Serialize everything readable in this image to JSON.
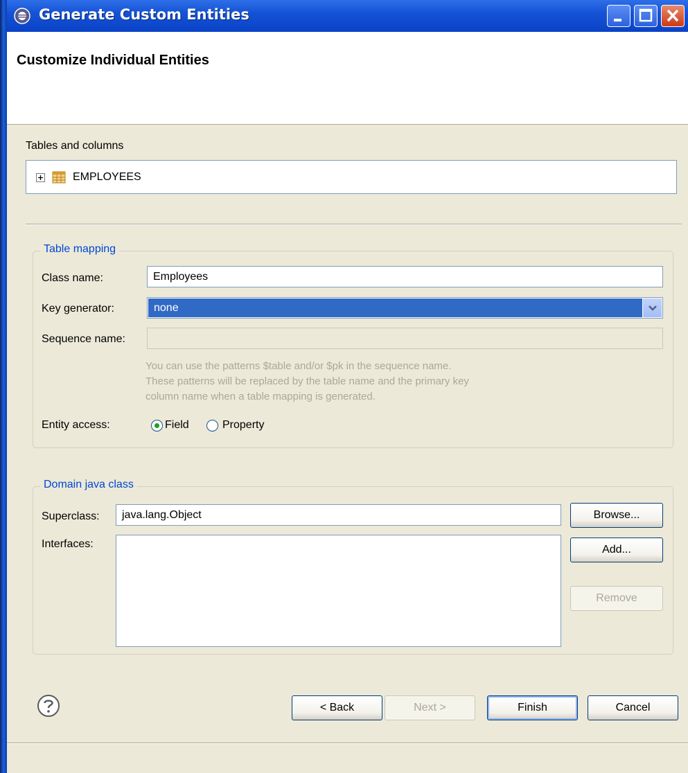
{
  "window": {
    "title": "Generate Custom Entities",
    "minimize_label": "_",
    "maximize_label": "☐",
    "close_label": "✕"
  },
  "header": {
    "title": "Customize Individual Entities"
  },
  "tables": {
    "label": "Tables and columns",
    "items": [
      {
        "expander": "⊞",
        "label": "EMPLOYEES"
      }
    ]
  },
  "table_mapping": {
    "legend": "Table mapping",
    "class_name_label": "Class name:",
    "class_name_value": "Employees",
    "key_generator_label": "Key generator:",
    "key_generator_value": "none",
    "sequence_name_label": "Sequence name:",
    "sequence_name_value": "",
    "hint_lines": [
      "You can use the patterns $table and/or $pk in the sequence name.",
      "These patterns will be replaced by the table name and the primary key",
      "column name when a table mapping is generated."
    ],
    "entity_access_label": "Entity access:",
    "access_options": [
      {
        "label": "Field",
        "selected": true
      },
      {
        "label": "Property",
        "selected": false
      }
    ]
  },
  "domain": {
    "legend": "Domain java class",
    "superclass_label": "Superclass:",
    "superclass_value": "java.lang.Object",
    "interfaces_label": "Interfaces:",
    "browse_label": "Browse...",
    "add_label": "Add...",
    "remove_label": "Remove"
  },
  "footer": {
    "help_icon": "?",
    "back_label": "< Back",
    "next_label": "Next >",
    "finish_label": "Finish",
    "cancel_label": "Cancel"
  },
  "colors": {
    "titlebar": "#0A42C6",
    "dialog_bg": "#ECE9D8",
    "group_legend": "#0046D5",
    "selection": "#316AC5",
    "radio_selected": "#21A121"
  }
}
